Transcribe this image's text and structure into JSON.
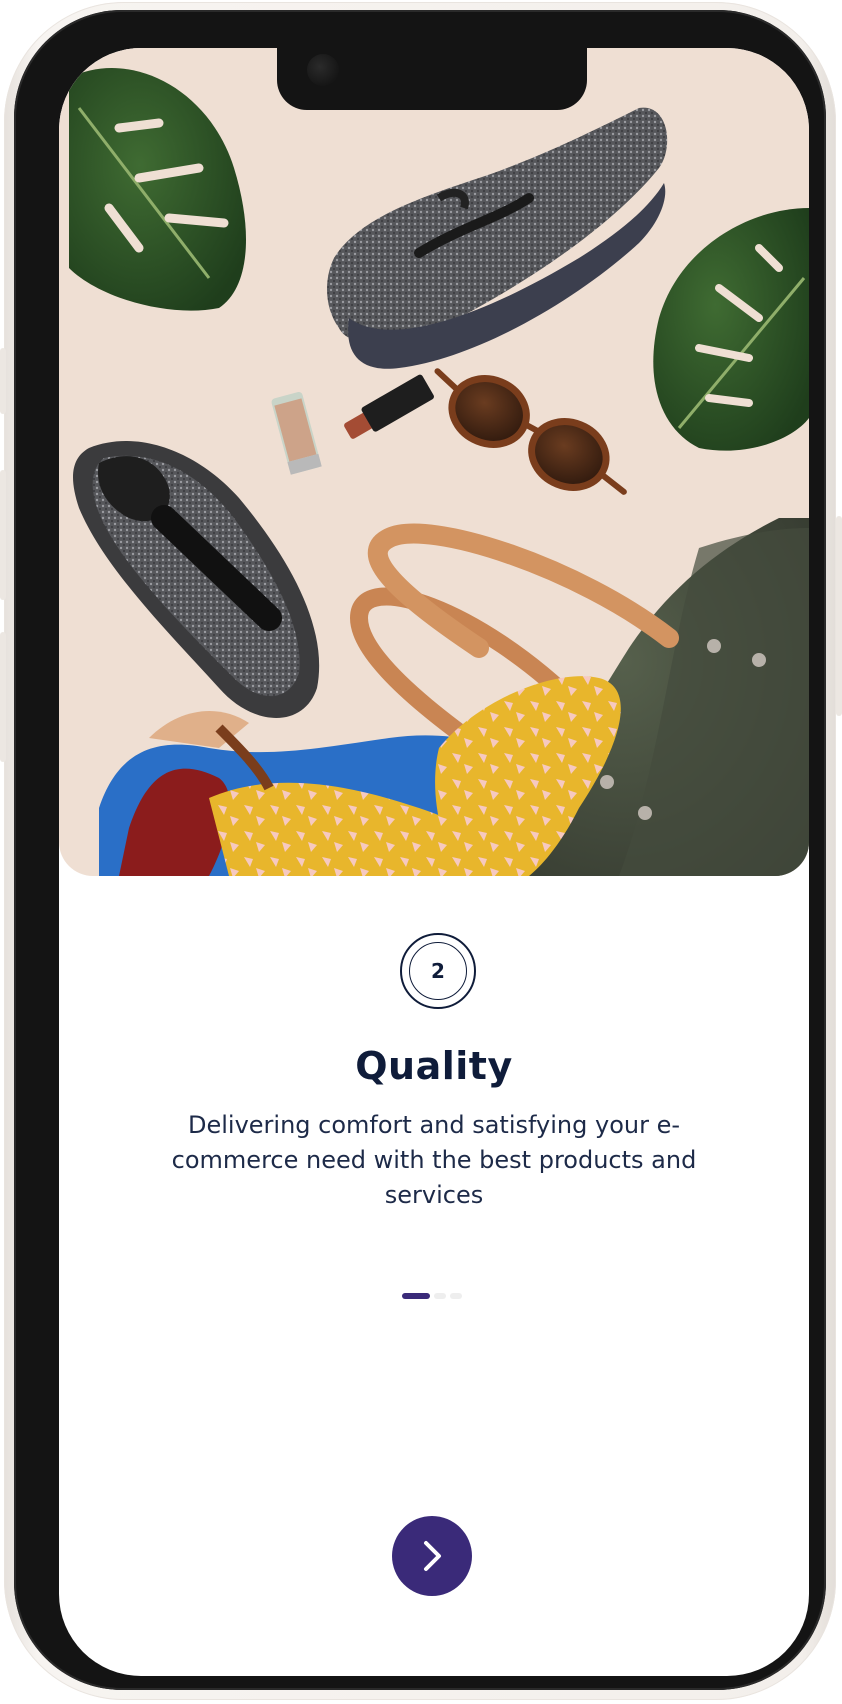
{
  "onboarding": {
    "step_number": "2",
    "title": "Quality",
    "description": "Delivering comfort and satisfying your e-commerce need with the best products and services",
    "pagination": {
      "total_pages": 3,
      "active_index": 0
    },
    "next_button_icon": "chevron-right-icon",
    "hero_image": "flat lay of sneakers, sunglasses, lipstick, scarf and leather tote bag with monstera leaves"
  },
  "colors": {
    "accent": "#3a2a79",
    "text_dark": "#0f1c3a",
    "hero_background": "#efdfd3",
    "dot_inactive": "#eeeeee"
  }
}
